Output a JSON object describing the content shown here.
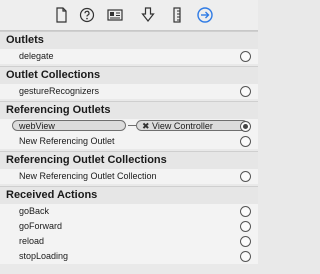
{
  "toolbar": {
    "icons": [
      "file-inspector-icon",
      "quick-help-icon",
      "identity-inspector-icon",
      "attributes-inspector-icon",
      "size-inspector-icon",
      "connections-inspector-icon"
    ]
  },
  "sections": {
    "outlets": {
      "title": "Outlets",
      "items": [
        "delegate"
      ]
    },
    "outlet_collections": {
      "title": "Outlet Collections",
      "items": [
        "gestureRecognizers"
      ]
    },
    "referencing_outlets": {
      "title": "Referencing Outlets",
      "connection": {
        "source": "webView",
        "target": "View Controller"
      },
      "new_label": "New Referencing Outlet"
    },
    "referencing_outlet_collections": {
      "title": "Referencing Outlet Collections",
      "new_label": "New Referencing Outlet Collection"
    },
    "received_actions": {
      "title": "Received Actions",
      "items": [
        "goBack",
        "goForward",
        "reload",
        "stopLoading"
      ]
    }
  },
  "colors": {
    "accent": "#2f7be5"
  }
}
